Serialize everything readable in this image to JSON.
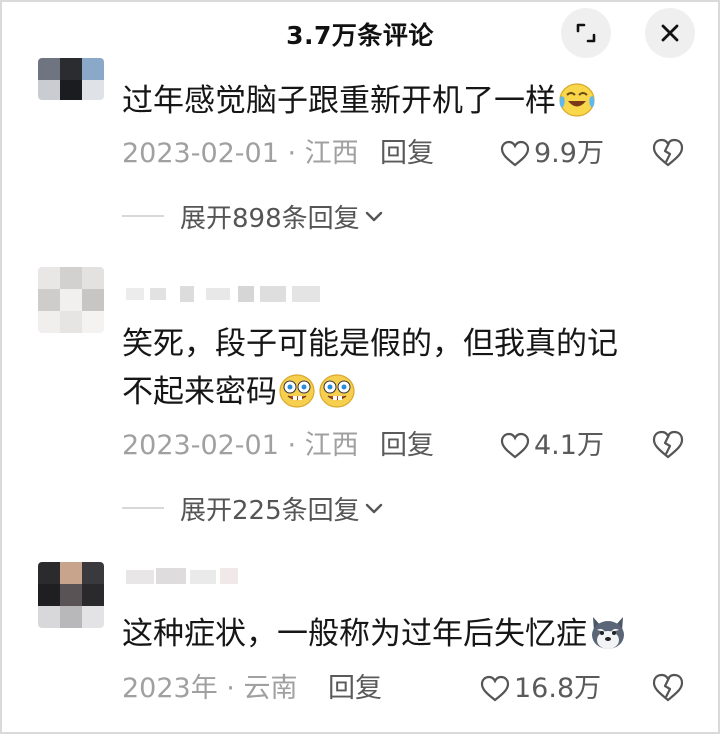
{
  "header": {
    "title": "3.7万条评论",
    "expand_icon": "expand-icon",
    "close_icon": "close-icon"
  },
  "comments": [
    {
      "text_line1": "过年感觉脑子跟重新开机了一样",
      "text_line2": "",
      "emoji": "crying-laughing-emoji",
      "date_location": "2023-02-01 · 江西",
      "reply_label": "回复",
      "likes": "9.9万",
      "expand_replies": "展开898条回复"
    },
    {
      "text_line1": "笑死，段子可能是假的，但我真的记",
      "text_line2": "不起来密码",
      "emoji": "spongebob-emoji",
      "date_location": "2023-02-01 · 江西",
      "reply_label": "回复",
      "likes": "4.1万",
      "expand_replies": "展开225条回复"
    },
    {
      "text_line1": "这种症状，一般称为过年后失忆症",
      "text_line2": "",
      "emoji": "husky-emoji",
      "date_location": "2023年 · 云南",
      "reply_label": "回复",
      "likes": "16.8万",
      "expand_replies": ""
    }
  ],
  "colors": {
    "primary_text": "#161616",
    "secondary_text": "#a0a0a0",
    "action_text": "#5a5a5a",
    "button_bg": "#efefef"
  }
}
